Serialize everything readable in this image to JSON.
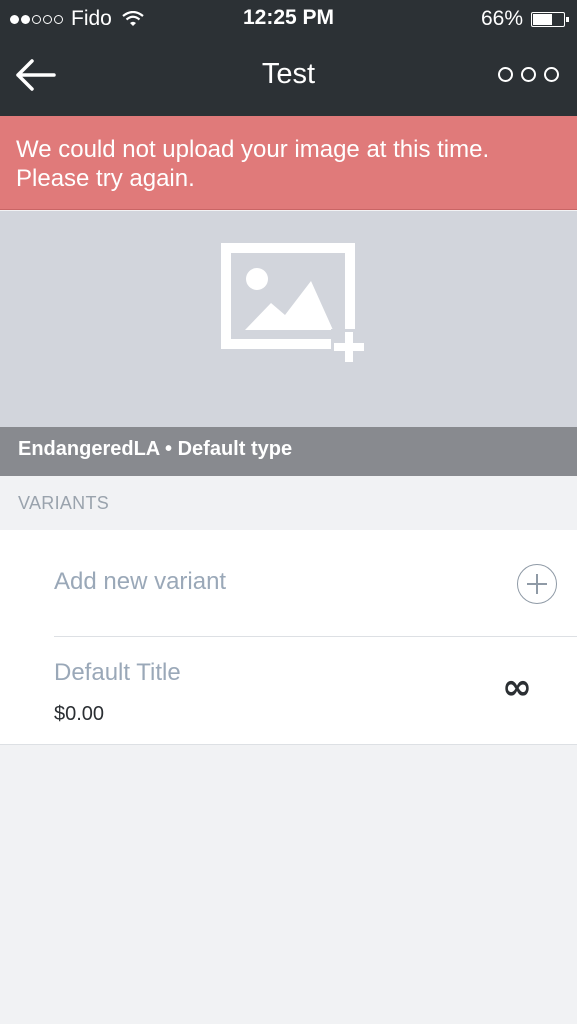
{
  "status_bar": {
    "signal_icon": "signal-dots-icon",
    "carrier": "Fido",
    "wifi_icon": "wifi-icon",
    "time": "12:25 PM",
    "battery_text": "66%",
    "battery_level": 0.66
  },
  "navbar": {
    "back_icon": "arrow-left-icon",
    "title": "Test",
    "more_icon": "more-horizontal-icon"
  },
  "error": {
    "message": "We could not upload your image at this time. Please try again.",
    "color": "#e07a7a"
  },
  "image_placeholder": {
    "icon": "add-image-icon",
    "caption": "EndangeredLA • Default type"
  },
  "variants": {
    "header": "VARIANTS",
    "add_label": "Add new variant",
    "add_icon": "add-circle-icon",
    "items": [
      {
        "title": "Default Title",
        "price": "$0.00",
        "inventory": "∞"
      }
    ]
  }
}
